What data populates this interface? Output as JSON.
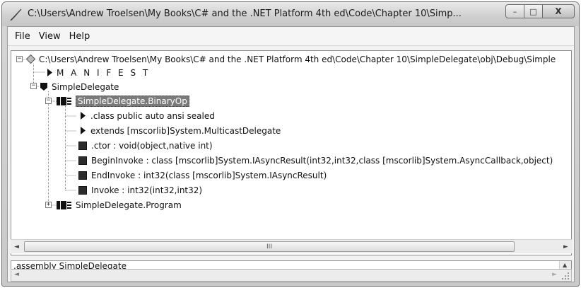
{
  "window": {
    "title": "C:\\Users\\Andrew Troelsen\\My Books\\C# and the .NET Platform 4th ed\\Code\\Chapter 10\\Simp...",
    "minimize_glyph": "–",
    "maximize_glyph": "□",
    "close_glyph": "X"
  },
  "menu": {
    "items": [
      "File",
      "View",
      "Help"
    ]
  },
  "tree": {
    "root_label": "C:\\Users\\Andrew Troelsen\\My Books\\C# and the .NET Platform 4th ed\\Code\\Chapter 10\\SimpleDelegate\\obj\\Debug\\Simple",
    "manifest_label": "M A N I F E S T",
    "namespace_label": "SimpleDelegate",
    "binaryop_label": "SimpleDelegate.BinaryOp",
    "binaryop_children": [
      ".class public auto ansi sealed",
      "extends [mscorlib]System.MulticastDelegate",
      ".ctor : void(object,native int)",
      "BeginInvoke : class [mscorlib]System.IAsyncResult(int32,int32,class [mscorlib]System.AsyncCallback,object)",
      "EndInvoke : int32(class [mscorlib]System.IAsyncResult)",
      "Invoke : int32(int32,int32)"
    ],
    "program_label": "SimpleDelegate.Program"
  },
  "scrollbar": {
    "thumb_grip": "III",
    "left_arrow": "◄",
    "right_arrow": "►",
    "up_arrow": "▲",
    "down_arrow": "▼"
  },
  "code_pane": {
    "line1": ".assembly SimpleDelegate",
    "line2": "{"
  }
}
